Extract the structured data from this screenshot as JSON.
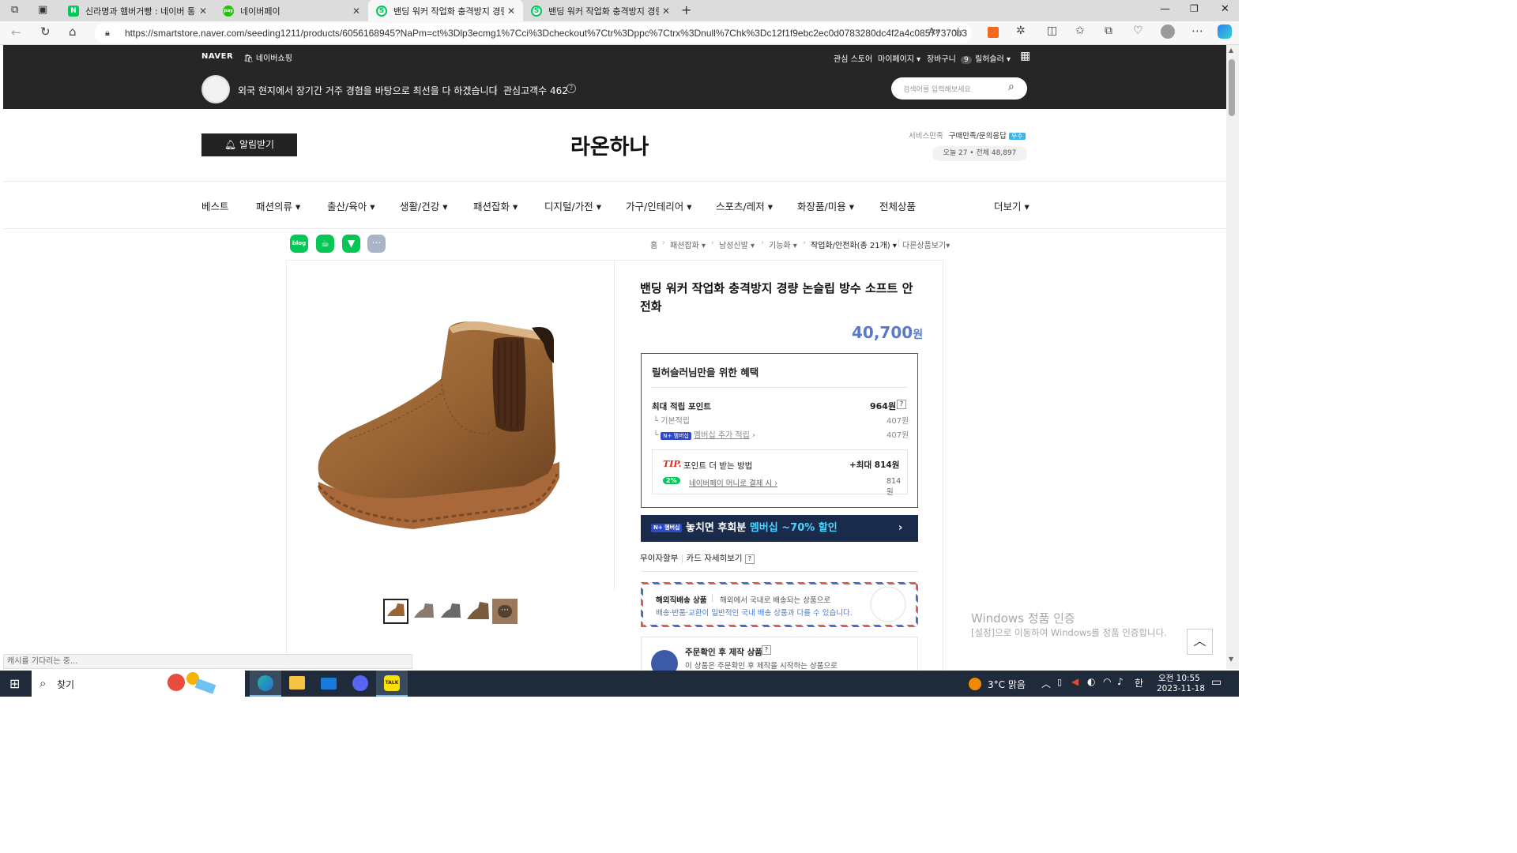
{
  "browser": {
    "tabs": [
      {
        "title": "신라명과 햄버거빵 : 네이버 통합",
        "favicon_color": "#03c75a",
        "favicon_text": "N"
      },
      {
        "title": "네이버페이",
        "favicon_color": "#1ec800",
        "favicon_text": "pay"
      },
      {
        "title": "밴딩 워커 작업화 충격방지 경량",
        "favicon_color": "#03c75a",
        "favicon_text": "S"
      },
      {
        "title": "밴딩 워커 작업화 충격방지 경량",
        "favicon_color": "#03c75a",
        "favicon_text": "S"
      }
    ],
    "url": "https://smartstore.naver.com/seeding1211/products/6056168945?NaPm=ct%3Dlp3ecmg1%7Cci%3Dcheckout%7Ctr%3Dppc%7Ctrx%3Dnull%7Chk%3Dc12f1f9ebc2ec0d0783280dc4f2a4c08577370b3"
  },
  "header": {
    "naver_logo": "NAVER",
    "shopping_link": "네이버쇼핑",
    "links": [
      "관심 스토어",
      "마이페이지",
      "장바구니",
      "릴허슬러"
    ],
    "cart_count": "9",
    "store_intro": "외국 현지에서 장기간 거주 경험을 바탕으로 최선을 다 하겠습니다",
    "interest_label": "관심고객수 462",
    "search_placeholder": "검색어를 입력해보세요"
  },
  "store": {
    "alarm_button": "알림받기",
    "name": "라온하나",
    "service_label": "서비스만족",
    "service_value": "구매만족/문의응답",
    "service_badge": "우수",
    "visitors": "오늘 27 • 전체 48,897"
  },
  "categories": [
    "베스트",
    "패션의류",
    "출산/육아",
    "생활/건강",
    "패션잡화",
    "디지털/가전",
    "가구/인테리어",
    "스포츠/레저",
    "화장품/미용",
    "전체상품",
    "더보기"
  ],
  "breadcrumb": [
    "홈",
    "패션잡화",
    "남성신발",
    "기능화",
    "작업화/안전화(총 21개)",
    "다른상품보기"
  ],
  "product": {
    "title": "밴딩 워커 작업화 충격방지 경량 논슬립 방수 소프트 안전화",
    "price": "40,700",
    "currency": "원",
    "benefit_title": "릴허슬러님만을 위한 혜택",
    "max_point_label": "최대 적립 포인트",
    "max_point_value": "964원",
    "basic_label": "기본적립",
    "basic_value": "407원",
    "membership_label": "멤버십 추가 적립",
    "membership_value": "407원",
    "tip_label": "TIP.",
    "tip_text": "포인트 더 받는 방법",
    "tip_max": "+최대 814원",
    "pay_percent": "2%",
    "pay_label": "네이버페이 머니로 결제 시",
    "pay_value": "814원",
    "banner_text": "놓치면 후회분",
    "banner_highlight": "멤버십 ~70% 할인",
    "installment": "무이자할부",
    "card_details": "카드 자세히보기",
    "overseas_title": "해외직배송 상품",
    "overseas_desc": "해외에서 국내로 배송되는 상품으로",
    "overseas_note": "배송·반품·교환이 일반적인 국내 배송 상품과 다를 수 있습니다.",
    "made_title": "주문확인 후 제작 상품",
    "made_desc": "이 상품은 주문확인 후 제작을 시작하는 상품으로"
  },
  "windows_watermark": {
    "line1": "Windows 정품 인증",
    "line2": "[설정]으로 이동하여 Windows를 정품 인증합니다."
  },
  "status_text": "캐시를 기다리는 중...",
  "taskbar": {
    "search": "찾기",
    "weather": "3°C 맑음",
    "time": "오전 10:55",
    "date": "2023-11-18"
  },
  "colors": {
    "brand": "#03c75a",
    "price": "#5a79cc",
    "dark_header": "#262626",
    "membership_banner": "#1a2a4a"
  }
}
